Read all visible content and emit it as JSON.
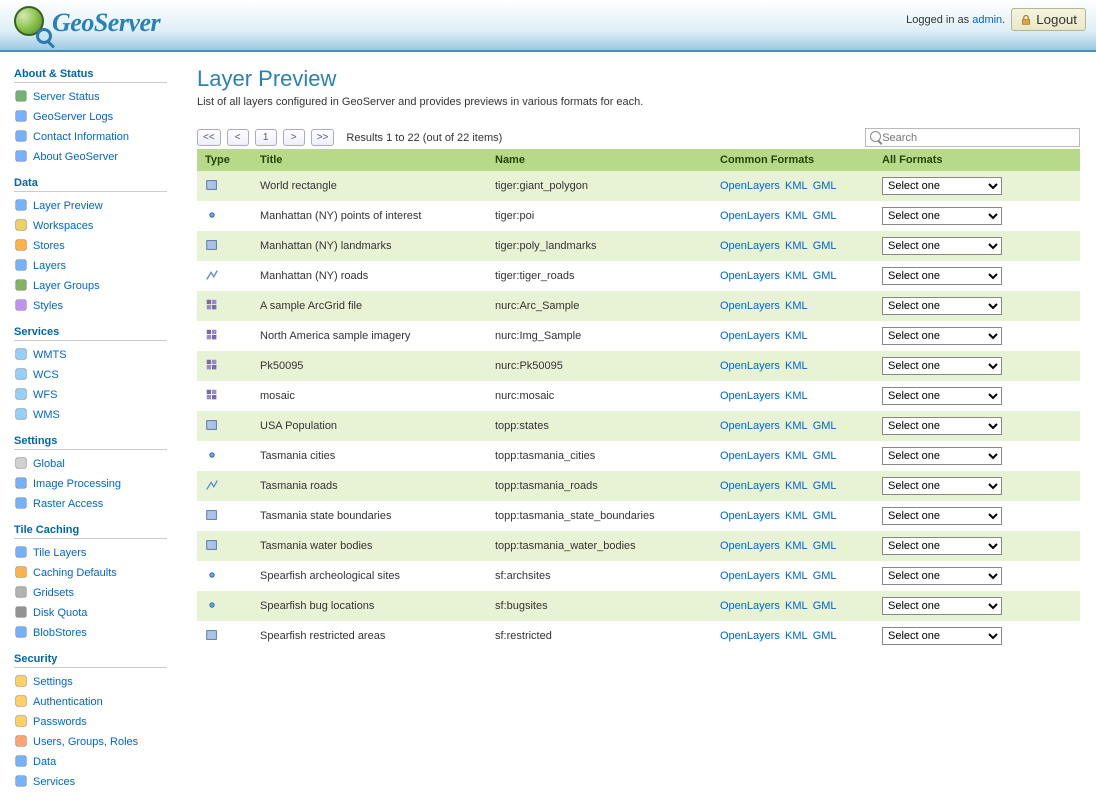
{
  "brand": "GeoServer",
  "header": {
    "logged_in_text": "Logged in as ",
    "username": "admin",
    "logout_label": "Logout"
  },
  "sidebar": {
    "sections": [
      {
        "title": "About & Status",
        "items": [
          {
            "label": "Server Status",
            "icon": "status"
          },
          {
            "label": "GeoServer Logs",
            "icon": "logs"
          },
          {
            "label": "Contact Information",
            "icon": "contact"
          },
          {
            "label": "About GeoServer",
            "icon": "about"
          }
        ]
      },
      {
        "title": "Data",
        "items": [
          {
            "label": "Layer Preview",
            "icon": "preview"
          },
          {
            "label": "Workspaces",
            "icon": "folder"
          },
          {
            "label": "Stores",
            "icon": "store"
          },
          {
            "label": "Layers",
            "icon": "layers"
          },
          {
            "label": "Layer Groups",
            "icon": "layergroups"
          },
          {
            "label": "Styles",
            "icon": "styles"
          }
        ]
      },
      {
        "title": "Services",
        "items": [
          {
            "label": "WMTS",
            "icon": "wmts"
          },
          {
            "label": "WCS",
            "icon": "wcs"
          },
          {
            "label": "WFS",
            "icon": "wfs"
          },
          {
            "label": "WMS",
            "icon": "wms"
          }
        ]
      },
      {
        "title": "Settings",
        "items": [
          {
            "label": "Global",
            "icon": "global"
          },
          {
            "label": "Image Processing",
            "icon": "imageproc"
          },
          {
            "label": "Raster Access",
            "icon": "raster"
          }
        ]
      },
      {
        "title": "Tile Caching",
        "items": [
          {
            "label": "Tile Layers",
            "icon": "tilelayers"
          },
          {
            "label": "Caching Defaults",
            "icon": "cachedefault"
          },
          {
            "label": "Gridsets",
            "icon": "gridsets"
          },
          {
            "label": "Disk Quota",
            "icon": "quota"
          },
          {
            "label": "BlobStores",
            "icon": "blob"
          }
        ]
      },
      {
        "title": "Security",
        "items": [
          {
            "label": "Settings",
            "icon": "secsettings"
          },
          {
            "label": "Authentication",
            "icon": "auth"
          },
          {
            "label": "Passwords",
            "icon": "passwords"
          },
          {
            "label": "Users, Groups, Roles",
            "icon": "users"
          },
          {
            "label": "Data",
            "icon": "secdata"
          },
          {
            "label": "Services",
            "icon": "secservices"
          }
        ]
      }
    ]
  },
  "page": {
    "title": "Layer Preview",
    "description": "List of all layers configured in GeoServer and provides previews in various formats for each.",
    "pager": {
      "first": "<<",
      "prev": "<",
      "current": "1",
      "next": ">",
      "last": ">>"
    },
    "results_text": "Results 1 to 22 (out of 22 items)",
    "search_placeholder": "Search",
    "columns": {
      "type": "Type",
      "title": "Title",
      "name": "Name",
      "common": "Common Formats",
      "all": "All Formats"
    },
    "select_default": "Select one",
    "rows": [
      {
        "type": "polygon",
        "title": "World rectangle",
        "name": "tiger:giant_polygon",
        "formats": [
          "OpenLayers",
          "KML",
          "GML"
        ]
      },
      {
        "type": "point",
        "title": "Manhattan (NY) points of interest",
        "name": "tiger:poi",
        "formats": [
          "OpenLayers",
          "KML",
          "GML"
        ]
      },
      {
        "type": "polygon",
        "title": "Manhattan (NY) landmarks",
        "name": "tiger:poly_landmarks",
        "formats": [
          "OpenLayers",
          "KML",
          "GML"
        ]
      },
      {
        "type": "line",
        "title": "Manhattan (NY) roads",
        "name": "tiger:tiger_roads",
        "formats": [
          "OpenLayers",
          "KML",
          "GML"
        ]
      },
      {
        "type": "raster",
        "title": "A sample ArcGrid file",
        "name": "nurc:Arc_Sample",
        "formats": [
          "OpenLayers",
          "KML"
        ]
      },
      {
        "type": "raster",
        "title": "North America sample imagery",
        "name": "nurc:Img_Sample",
        "formats": [
          "OpenLayers",
          "KML"
        ]
      },
      {
        "type": "raster",
        "title": "Pk50095",
        "name": "nurc:Pk50095",
        "formats": [
          "OpenLayers",
          "KML"
        ]
      },
      {
        "type": "raster",
        "title": "mosaic",
        "name": "nurc:mosaic",
        "formats": [
          "OpenLayers",
          "KML"
        ]
      },
      {
        "type": "polygon",
        "title": "USA Population",
        "name": "topp:states",
        "formats": [
          "OpenLayers",
          "KML",
          "GML"
        ]
      },
      {
        "type": "point",
        "title": "Tasmania cities",
        "name": "topp:tasmania_cities",
        "formats": [
          "OpenLayers",
          "KML",
          "GML"
        ]
      },
      {
        "type": "line",
        "title": "Tasmania roads",
        "name": "topp:tasmania_roads",
        "formats": [
          "OpenLayers",
          "KML",
          "GML"
        ]
      },
      {
        "type": "polygon",
        "title": "Tasmania state boundaries",
        "name": "topp:tasmania_state_boundaries",
        "formats": [
          "OpenLayers",
          "KML",
          "GML"
        ]
      },
      {
        "type": "polygon",
        "title": "Tasmania water bodies",
        "name": "topp:tasmania_water_bodies",
        "formats": [
          "OpenLayers",
          "KML",
          "GML"
        ]
      },
      {
        "type": "point",
        "title": "Spearfish archeological sites",
        "name": "sf:archsites",
        "formats": [
          "OpenLayers",
          "KML",
          "GML"
        ]
      },
      {
        "type": "point",
        "title": "Spearfish bug locations",
        "name": "sf:bugsites",
        "formats": [
          "OpenLayers",
          "KML",
          "GML"
        ]
      },
      {
        "type": "polygon",
        "title": "Spearfish restricted areas",
        "name": "sf:restricted",
        "formats": [
          "OpenLayers",
          "KML",
          "GML"
        ]
      }
    ]
  }
}
